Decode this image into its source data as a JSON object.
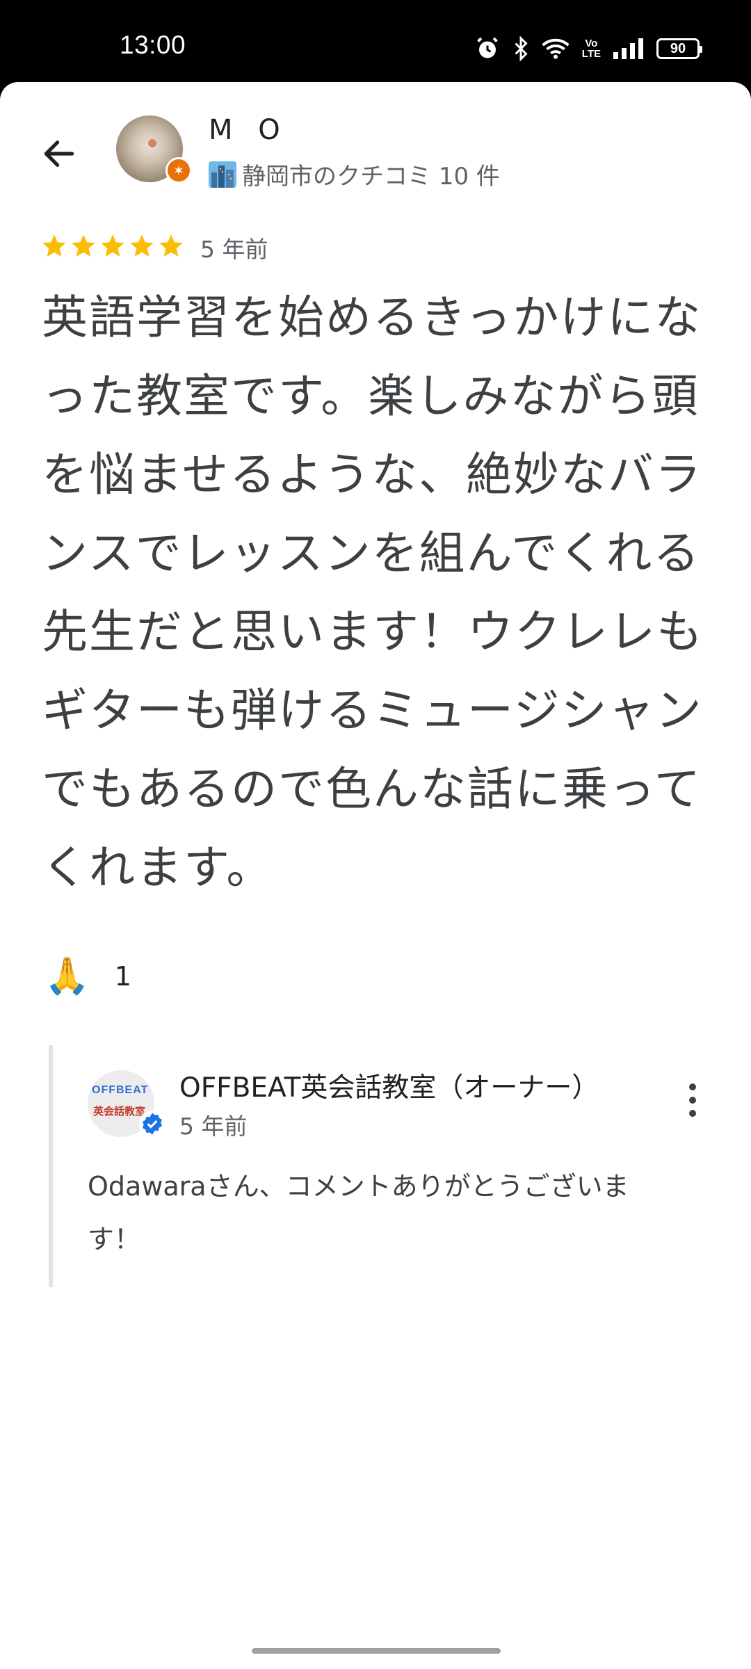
{
  "status_bar": {
    "time": "13:00",
    "battery": "90",
    "icons": [
      "alarm-icon",
      "bluetooth-icon",
      "wifi-icon",
      "volte-icon",
      "signal-icon",
      "battery-icon"
    ]
  },
  "reviewer": {
    "name": "M O",
    "subtitle": "静岡市のクチコミ 10 件",
    "badge": "local-guide-badge"
  },
  "review": {
    "rating": 5,
    "max_rating": 5,
    "time": "5 年前",
    "text": "英語学習を始めるきっかけになった教室です。楽しみながら頭を悩ませるような、絶妙なバランスでレッスンを組んでくれる先生だと思います！ウクレレもギターも弾けるミュージシャンでもあるので色んな話に乗ってくれます。"
  },
  "reaction": {
    "emoji": "🙏",
    "count": "1"
  },
  "owner_reply": {
    "owner_name": "OFFBEAT英会話教室（オーナー）",
    "time": "5 年前",
    "text": "Odawaraさん、コメントありがとうございます！",
    "logo_top": "OFFBEAT",
    "logo_bottom": "英会話教室"
  },
  "colors": {
    "star": "#fbbc04",
    "guide_badge": "#e8710a",
    "verified": "#1a73e8"
  }
}
